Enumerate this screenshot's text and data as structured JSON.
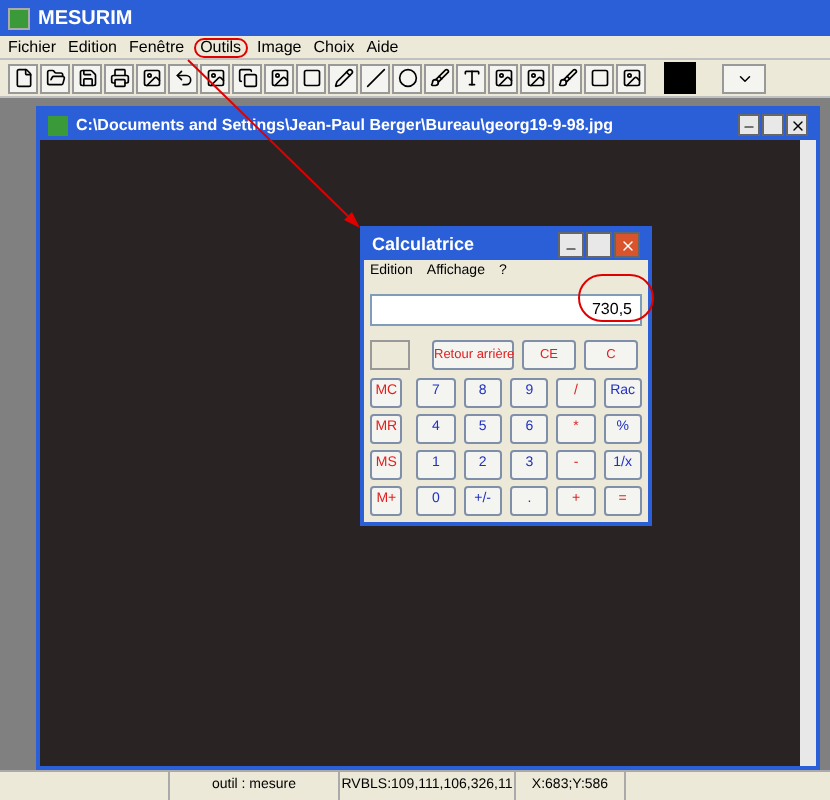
{
  "window": {
    "title": "MESURIM"
  },
  "menu": [
    {
      "label": "Fichier",
      "highlighted": false
    },
    {
      "label": "Edition",
      "highlighted": false
    },
    {
      "label": "Fenêtre",
      "highlighted": false
    },
    {
      "label": "Outils",
      "highlighted": true
    },
    {
      "label": "Image",
      "highlighted": false
    },
    {
      "label": "Choix",
      "highlighted": false
    },
    {
      "label": "Aide",
      "highlighted": false
    }
  ],
  "document": {
    "title": "C:\\Documents and Settings\\Jean-Paul Berger\\Bureau\\georg19-9-98.jpg"
  },
  "calculator": {
    "title": "Calculatrice",
    "menu": [
      {
        "label": "Edition"
      },
      {
        "label": "Affichage"
      },
      {
        "label": "?"
      }
    ],
    "display": "730,5",
    "display_highlighted": true,
    "top_buttons": [
      {
        "label": "Retour arrière"
      },
      {
        "label": "CE"
      },
      {
        "label": "C"
      }
    ],
    "buttons": [
      {
        "label": "MC",
        "kind": "memory"
      },
      {
        "label": "7",
        "kind": "digit"
      },
      {
        "label": "8",
        "kind": "digit"
      },
      {
        "label": "9",
        "kind": "digit"
      },
      {
        "label": "/",
        "kind": "operator"
      },
      {
        "label": "Rac",
        "kind": "digit"
      },
      {
        "label": "MR",
        "kind": "memory"
      },
      {
        "label": "4",
        "kind": "digit"
      },
      {
        "label": "5",
        "kind": "digit"
      },
      {
        "label": "6",
        "kind": "digit"
      },
      {
        "label": "*",
        "kind": "operator"
      },
      {
        "label": "%",
        "kind": "digit"
      },
      {
        "label": "MS",
        "kind": "memory"
      },
      {
        "label": "1",
        "kind": "digit"
      },
      {
        "label": "2",
        "kind": "digit"
      },
      {
        "label": "3",
        "kind": "digit"
      },
      {
        "label": "-",
        "kind": "operator"
      },
      {
        "label": "1/x",
        "kind": "digit"
      },
      {
        "label": "M+",
        "kind": "memory"
      },
      {
        "label": "0",
        "kind": "digit"
      },
      {
        "label": "+/-",
        "kind": "digit"
      },
      {
        "label": ".",
        "kind": "digit"
      },
      {
        "label": "+",
        "kind": "operator"
      },
      {
        "label": "=",
        "kind": "operator"
      }
    ]
  },
  "status_bar": [
    {
      "text": "outil : mesure"
    },
    {
      "text": "RVBLS:109,111,106,326,11"
    },
    {
      "text": "X:683;Y:586"
    }
  ]
}
